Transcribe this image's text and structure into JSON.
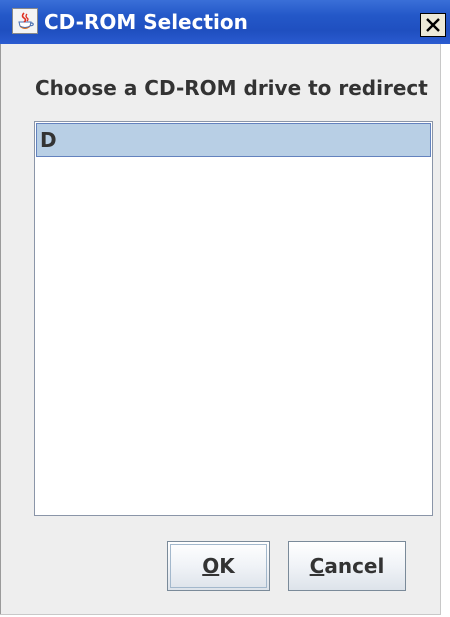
{
  "window": {
    "title": "CD-ROM Selection",
    "icon": "java-cup-icon",
    "close_icon": "close-x-icon"
  },
  "prompt": "Choose a CD-ROM drive to redirect",
  "drive_list": {
    "items": [
      {
        "label": "D",
        "selected": true
      }
    ]
  },
  "buttons": {
    "ok": {
      "mnemonic": "O",
      "rest": "K"
    },
    "cancel": {
      "mnemonic": "C",
      "rest": "ancel"
    }
  },
  "colors": {
    "titlebar": "#2458c8",
    "selection": "#b8cfe5",
    "dialog_bg": "#eeeeee"
  }
}
